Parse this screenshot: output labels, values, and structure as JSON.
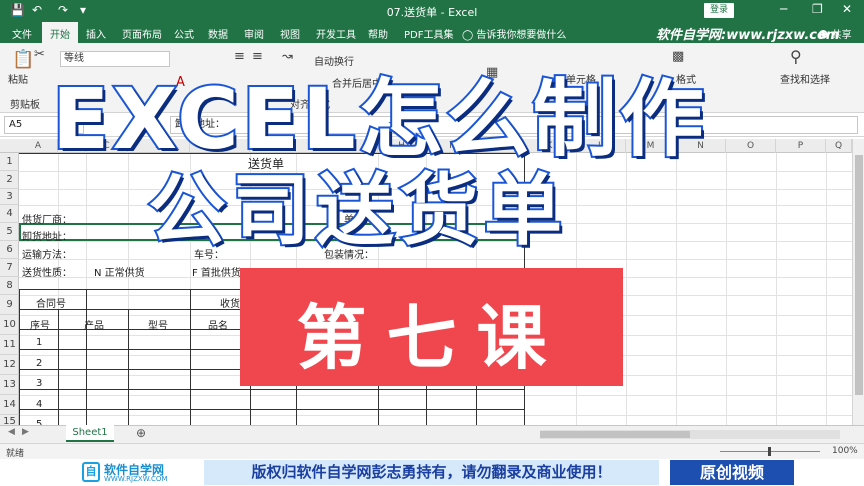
{
  "titlebar": {
    "doc_title": "07.送货单 - Excel",
    "login": "登录",
    "save_icon": "save-icon",
    "undo_icon": "undo-icon",
    "redo_icon": "redo-icon",
    "minimize": "─",
    "restore": "❐",
    "close": "✕"
  },
  "tabs": [
    {
      "label": "文件"
    },
    {
      "label": "开始"
    },
    {
      "label": "插入"
    },
    {
      "label": "页面布局"
    },
    {
      "label": "公式"
    },
    {
      "label": "数据"
    },
    {
      "label": "审阅"
    },
    {
      "label": "视图"
    },
    {
      "label": "开发工具"
    },
    {
      "label": "帮助"
    },
    {
      "label": "PDF工具集"
    }
  ],
  "tell_me": "告诉我你想要做什么",
  "watermark_url": "软件自学网:www.rjzxw.com",
  "share": "共享",
  "ribbon": {
    "font_name": "等线",
    "paste": "粘贴",
    "clipboard": "剪贴板",
    "wrap_text": "自动换行",
    "merge_center": "合并后居中",
    "alignment": "对齐方式",
    "cell_styles": "单元格",
    "format": "格式",
    "find_select": "查找和选择"
  },
  "formula_bar": {
    "name_box": "A5",
    "formula": "卸货地址："
  },
  "columns": [
    "A",
    "B",
    "C",
    "D",
    "E",
    "F",
    "G",
    "H",
    "I",
    "J",
    "K",
    "L",
    "M",
    "N",
    "O",
    "P",
    "Q"
  ],
  "rows": [
    "1",
    "2",
    "3",
    "4",
    "5",
    "6",
    "7",
    "8",
    "9",
    "10",
    "11",
    "12",
    "13",
    "14",
    "15"
  ],
  "cells": {
    "title_r1": "送货单",
    "supplier": "供货厂商：",
    "order_no": "单号：",
    "unload_addr": "卸货地址：",
    "transport": "运输方法：",
    "car_no": "车号：",
    "package": "包装情况：",
    "delivery_type": "送货性质：",
    "normal": "N 正常供货",
    "first_batch": "F 首批供货",
    "contract_no": "合同号",
    "receive": "收货",
    "seq": "序号",
    "product": "产品",
    "model": "型号",
    "item_name": "品名",
    "n1": "1",
    "n2": "2",
    "n3": "3",
    "n4": "4",
    "n5": "5"
  },
  "sheet_tab": "Sheet1",
  "status": {
    "ready": "就绪",
    "zoom": "100%"
  },
  "overlay": {
    "title_line1": "EXCEL怎么制作",
    "title_line2": "公司送货单",
    "lesson": "第七课"
  },
  "banner": {
    "logo_mark": "自",
    "site_name": "软件自学网",
    "site_url": "WWW.RJZXW.COM",
    "copyright": "版权归软件自学网彭志勇持有，请勿翻录及商业使用！",
    "original": "原创视频"
  },
  "colors": {
    "excel_green": "#217346",
    "overlay_stroke": "#1a55d6",
    "lesson_red": "#f0474e",
    "banner_blue": "#1d4fb0"
  }
}
